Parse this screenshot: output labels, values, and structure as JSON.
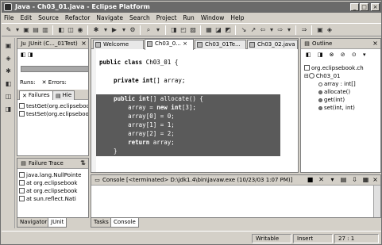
{
  "window": {
    "title": "Java - Ch03_01.java - Eclipse Platform",
    "buttons": [
      "_",
      "□",
      "×"
    ]
  },
  "menu": [
    "File",
    "Edit",
    "Source",
    "Refactor",
    "Navigate",
    "Search",
    "Project",
    "Run",
    "Window",
    "Help"
  ],
  "junit": {
    "title": "JUnit (C..._01Test)",
    "runs_label": "Runs:",
    "errors_label": "Errors:",
    "tabs": [
      "Failures",
      "Hie"
    ],
    "tests": [
      "testGet(org.eclipsebook",
      "testSet(org.eclipsebook"
    ]
  },
  "failure_trace": {
    "title": "Failure Trace",
    "lines": [
      "java.lang.NullPointe",
      "at org.eclipsebook",
      "at org.eclipsebook",
      "at sun.reflect.Nati"
    ]
  },
  "left_bottom_tabs": [
    "Navigator",
    "JUnit"
  ],
  "editor": {
    "tabs": [
      "Welcome",
      "Ch03_0...",
      "Ch03_01Te...",
      "Ch03_02.java"
    ],
    "code": [
      {
        "kw": "public class",
        "rest": " Ch03_01 {"
      },
      {
        "kw": "",
        "rest": ""
      },
      {
        "kw": "    private int",
        "rest": "[] array;"
      },
      {
        "kw": "",
        "rest": ""
      },
      {
        "kw": "    public int",
        "rest": "[] allocate() {"
      },
      {
        "kw": "",
        "rest": "        array = "
      },
      {
        "kw": "",
        "rest": "        array[0] = 0;"
      },
      {
        "kw": "",
        "rest": "        array[1] = 1;"
      },
      {
        "kw": "",
        "rest": "        array[2] = 2;"
      },
      {
        "kw": "        return",
        "rest": " array;"
      },
      {
        "kw": "",
        "rest": "    }"
      }
    ],
    "line6_new": "new int",
    "line6_end": "[3];"
  },
  "outline": {
    "title": "Outline",
    "items": [
      "org.eclipsebook.ch",
      "Ch03_01",
      "array : int[]",
      "allocate()",
      "get(int)",
      "set(int, int)"
    ]
  },
  "console": {
    "title": "Console [<terminated> D:\\jdk1.4\\bin\\javaw.exe (10/23/03 1:07 PM)]"
  },
  "bottom_tabs": [
    "Tasks",
    "Console"
  ],
  "status": {
    "mode": "Writable",
    "insert": "Insert",
    "position": "27 : 1"
  },
  "colors": {
    "selection": "#5a5a5a",
    "titlebar": "#6a6a6a"
  }
}
